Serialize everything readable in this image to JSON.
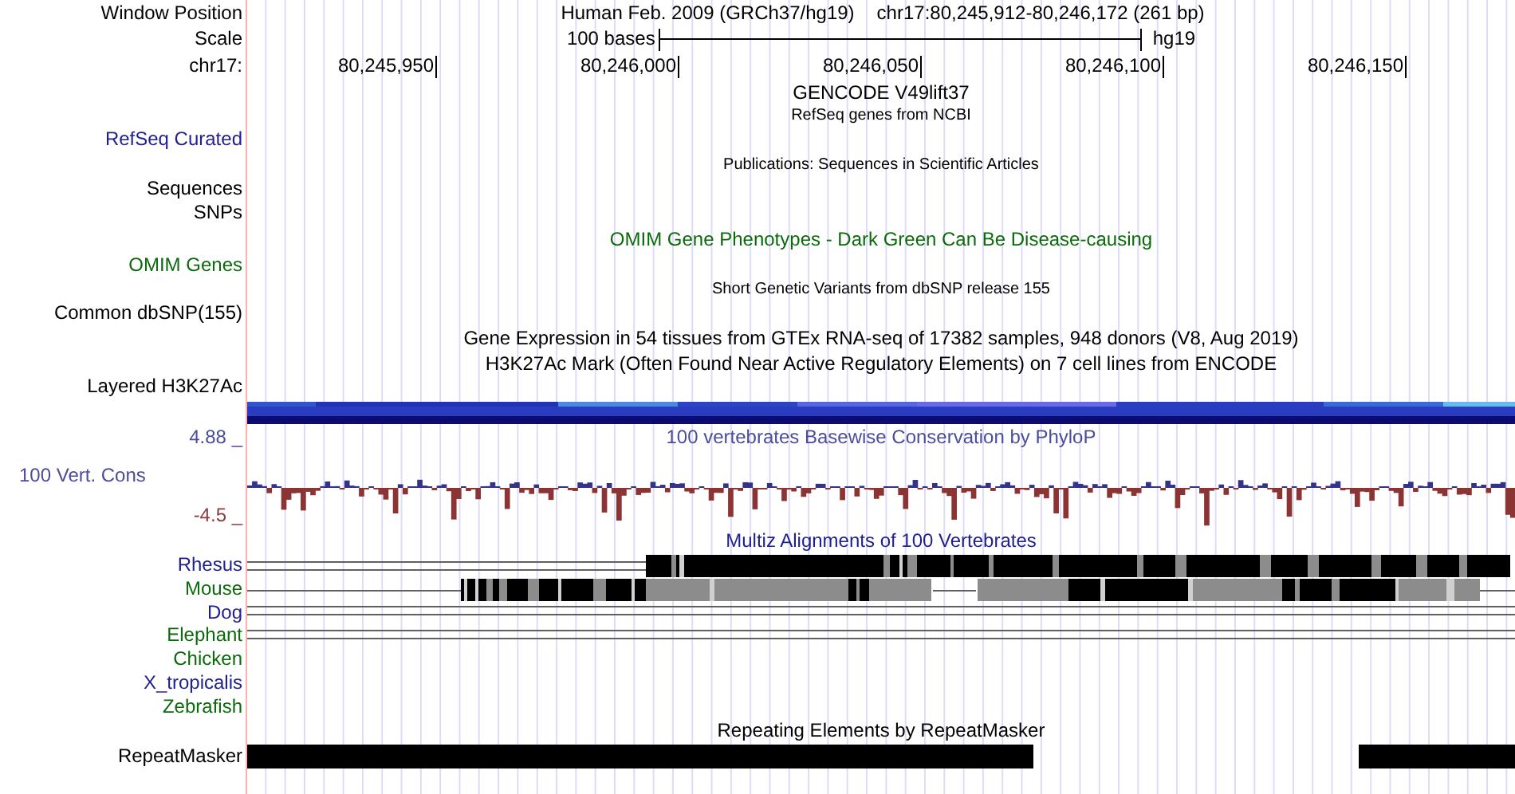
{
  "rows": [
    {
      "kind": "position",
      "label": "Window Position",
      "assembly": "Human Feb. 2009 (GRCh37/hg19)",
      "position": "chr17:80,245,912-80,246,172 (261 bp)"
    },
    {
      "kind": "scale",
      "label": "Scale",
      "scale": "100 bases",
      "db": "hg19"
    },
    {
      "kind": "ruler",
      "label": "chr17:",
      "ticks": [
        "80,245,950",
        "80,246,000",
        "80,246,050",
        "80,246,100",
        "80,246,150"
      ]
    },
    {
      "kind": "caption",
      "text": "GENCODE V49lift37",
      "color": "#000000"
    },
    {
      "kind": "note",
      "text": "RefSeq genes from NCBI"
    },
    {
      "kind": "label",
      "label": "RefSeq Curated",
      "color": "#1f1f8f"
    },
    {
      "kind": "note",
      "text": "Publications: Sequences in Scientific Articles"
    },
    {
      "kind": "label",
      "label": "Sequences",
      "color": "#000000"
    },
    {
      "kind": "label",
      "label": "SNPs",
      "color": "#000000"
    },
    {
      "kind": "caption",
      "text": "OMIM Gene Phenotypes - Dark Green Can Be Disease-causing",
      "color": "#0b6b0b"
    },
    {
      "kind": "label",
      "label": "OMIM Genes",
      "color": "#0b6b0b"
    },
    {
      "kind": "note",
      "text": "Short Genetic Variants from dbSNP release 155"
    },
    {
      "kind": "label",
      "label": "Common dbSNP(155)",
      "color": "#000000"
    },
    {
      "kind": "caption",
      "text": "Gene Expression in 54 tissues from GTEx RNA-seq of 17382 samples, 948 donors (V8, Aug 2019)",
      "color": "#000000"
    },
    {
      "kind": "caption",
      "text": "H3K27Ac Mark (Often Found Near Active Regulatory Elements) on 7 cell lines from ENCODE",
      "color": "#000000"
    },
    {
      "kind": "label",
      "label": "Layered H3K27Ac",
      "color": "#000000"
    },
    {
      "kind": "signal"
    },
    {
      "kind": "conservation",
      "label": "100 Vert. Cons",
      "max": "4.88 _",
      "min": "-4.5 _",
      "caption": "100 vertebrates Basewise Conservation by PhyloP"
    },
    {
      "kind": "caption",
      "text": "Multiz Alignments of 100 Vertebrates",
      "color": "#1f1f8f"
    },
    {
      "kind": "species",
      "label": "Rhesus",
      "color": "#1f1f8f"
    },
    {
      "kind": "species",
      "label": "Mouse",
      "color": "#0b6b0b"
    },
    {
      "kind": "species",
      "label": "Dog",
      "color": "#1f1f8f"
    },
    {
      "kind": "species",
      "label": "Elephant",
      "color": "#0b6b0b"
    },
    {
      "kind": "species",
      "label": "Chicken",
      "color": "#0b6b0b"
    },
    {
      "kind": "species",
      "label": "X_tropicalis",
      "color": "#1f1f8f"
    },
    {
      "kind": "species",
      "label": "Zebrafish",
      "color": "#0b6b0b"
    },
    {
      "kind": "caption",
      "text": "Repeating Elements by RepeatMasker",
      "color": "#000000"
    },
    {
      "kind": "repeats",
      "label": "RepeatMasker"
    }
  ]
}
